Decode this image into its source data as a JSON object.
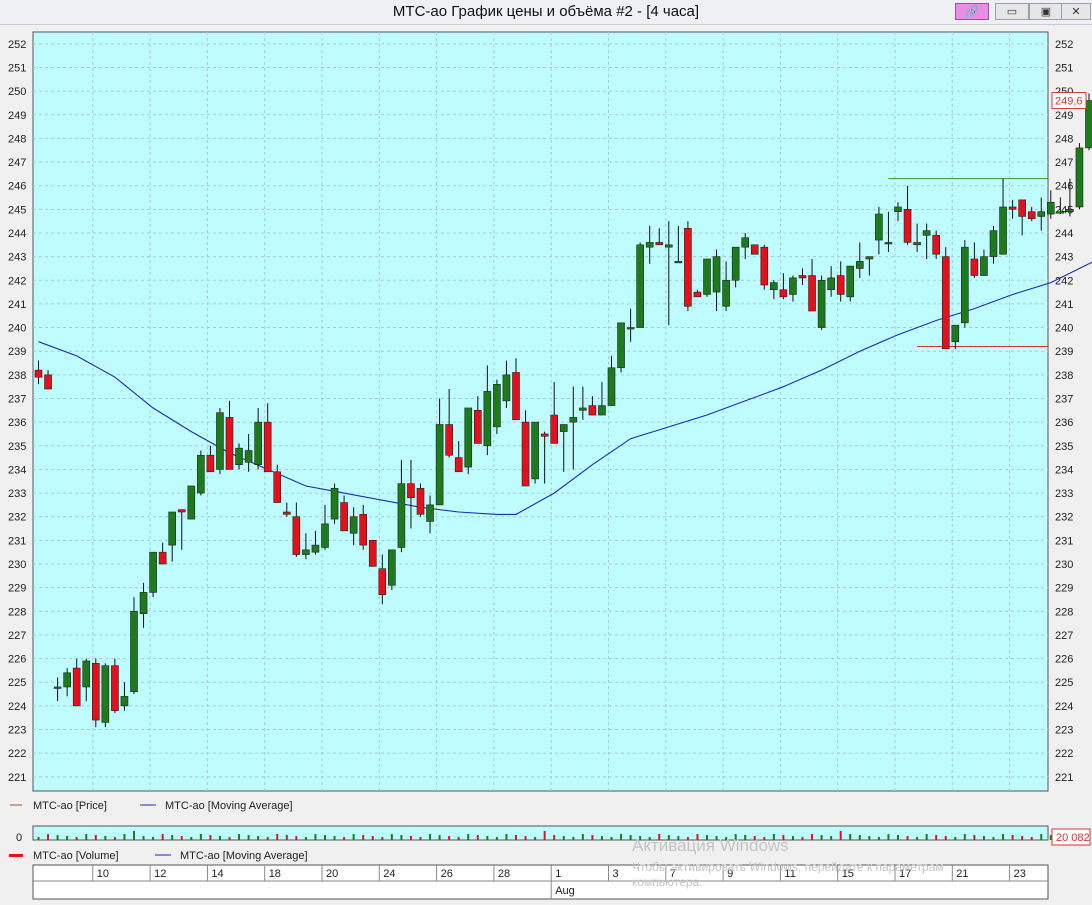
{
  "window": {
    "title": "МТС-ао График цены и объёма #2 - [4 часа]",
    "controls": [
      {
        "name": "link-icon",
        "glyph": "🔗"
      },
      {
        "name": "minimize-icon",
        "glyph": "▭"
      },
      {
        "name": "restore-icon",
        "glyph": "▣"
      },
      {
        "name": "close-icon",
        "glyph": "✕"
      }
    ]
  },
  "colors": {
    "background": "#bffcff",
    "grid": "#a8cccc",
    "up": "#1d7a1d",
    "down": "#e4101c",
    "ma": "#1a2cae",
    "resistance": "#2b9a2b",
    "support": "#d83030"
  },
  "chart_data": {
    "type": "candlestick",
    "ylim": [
      220.4,
      252.5
    ],
    "yticks": [
      221,
      222,
      223,
      224,
      225,
      226,
      227,
      228,
      229,
      230,
      231,
      232,
      233,
      234,
      235,
      236,
      237,
      238,
      239,
      240,
      241,
      242,
      243,
      244,
      245,
      246,
      247,
      248,
      249,
      250,
      251,
      252
    ],
    "grid": true,
    "candles": [
      [
        238.2,
        238.6,
        237.6,
        237.9
      ],
      [
        238.0,
        238.2,
        237.4,
        237.4
      ],
      [
        224.8,
        225.2,
        224.2,
        224.8
      ],
      [
        224.8,
        225.6,
        224.4,
        225.4
      ],
      [
        225.6,
        226.0,
        224.0,
        224.0
      ],
      [
        224.8,
        226.0,
        224.2,
        225.9
      ],
      [
        225.8,
        226.0,
        223.1,
        223.4
      ],
      [
        223.3,
        225.8,
        223.1,
        225.7
      ],
      [
        225.7,
        226.0,
        223.7,
        223.8
      ],
      [
        224.0,
        225.0,
        223.8,
        224.4
      ],
      [
        224.6,
        228.6,
        224.5,
        228.0
      ],
      [
        227.9,
        229.2,
        227.3,
        228.8
      ],
      [
        228.8,
        230.5,
        228.6,
        230.5
      ],
      [
        230.5,
        230.9,
        230.0,
        230.0
      ],
      [
        230.8,
        232.2,
        230.1,
        232.2
      ],
      [
        232.3,
        232.3,
        230.6,
        232.2
      ],
      [
        231.9,
        233.2,
        231.9,
        233.3
      ],
      [
        233.0,
        234.8,
        232.9,
        234.6
      ],
      [
        234.6,
        235.0,
        233.9,
        233.9
      ],
      [
        234.0,
        236.6,
        233.8,
        236.4
      ],
      [
        236.2,
        236.9,
        234.0,
        234.0
      ],
      [
        234.2,
        235.1,
        234.0,
        234.9
      ],
      [
        234.3,
        235.5,
        233.9,
        234.8
      ],
      [
        234.2,
        236.6,
        234.0,
        236.0
      ],
      [
        236.0,
        236.8,
        233.9,
        233.9
      ],
      [
        233.9,
        234.2,
        232.6,
        232.6
      ],
      [
        232.2,
        232.6,
        232.0,
        232.1
      ],
      [
        232.0,
        232.6,
        230.3,
        230.4
      ],
      [
        230.4,
        231.3,
        230.2,
        230.6
      ],
      [
        230.5,
        231.4,
        230.4,
        230.8
      ],
      [
        230.7,
        232.5,
        230.6,
        231.7
      ],
      [
        231.9,
        233.4,
        231.7,
        233.2
      ],
      [
        232.6,
        232.9,
        231.7,
        231.4
      ],
      [
        231.3,
        232.4,
        230.8,
        232.0
      ],
      [
        232.1,
        232.5,
        230.6,
        230.8
      ],
      [
        231.0,
        231.0,
        230.0,
        229.9
      ],
      [
        229.8,
        230.4,
        228.3,
        228.7
      ],
      [
        229.1,
        230.4,
        228.9,
        230.6
      ],
      [
        230.7,
        234.4,
        230.5,
        233.4
      ],
      [
        233.4,
        234.4,
        231.5,
        232.8
      ],
      [
        233.2,
        233.4,
        232.0,
        232.1
      ],
      [
        231.8,
        232.9,
        231.3,
        232.5
      ],
      [
        232.5,
        237.0,
        232.5,
        235.9
      ],
      [
        235.9,
        237.4,
        234.5,
        234.6
      ],
      [
        234.5,
        235.2,
        233.9,
        233.9
      ],
      [
        234.1,
        236.2,
        233.8,
        236.6
      ],
      [
        236.5,
        237.1,
        235.1,
        235.1
      ],
      [
        235.0,
        238.4,
        234.6,
        237.3
      ],
      [
        235.8,
        237.8,
        235.5,
        237.6
      ],
      [
        236.9,
        238.6,
        236.6,
        238.0
      ],
      [
        238.1,
        238.7,
        236.1,
        236.1
      ],
      [
        236.0,
        236.5,
        233.3,
        233.3
      ],
      [
        233.6,
        236.0,
        233.4,
        236.0
      ],
      [
        235.5,
        235.6,
        233.4,
        235.4
      ],
      [
        236.3,
        237.7,
        235.2,
        235.1
      ],
      [
        235.6,
        235.8,
        233.9,
        235.9
      ],
      [
        236.0,
        237.5,
        234.0,
        236.2
      ],
      [
        236.5,
        237.5,
        236.1,
        236.6
      ],
      [
        236.7,
        237.1,
        236.3,
        236.3
      ],
      [
        236.3,
        237.7,
        236.3,
        236.7
      ],
      [
        236.7,
        238.8,
        236.8,
        238.3
      ],
      [
        238.3,
        240.2,
        238.1,
        240.2
      ],
      [
        240.0,
        240.8,
        239.4,
        240.0
      ],
      [
        240.0,
        243.6,
        240.0,
        243.5
      ],
      [
        243.4,
        244.3,
        242.7,
        243.6
      ],
      [
        243.6,
        244.2,
        243.5,
        243.5
      ],
      [
        243.4,
        244.5,
        240.1,
        243.5
      ],
      [
        242.8,
        244.3,
        242.8,
        242.8
      ],
      [
        244.2,
        244.5,
        240.7,
        240.9
      ],
      [
        241.5,
        241.6,
        241.4,
        241.3
      ],
      [
        241.4,
        242.8,
        241.3,
        242.9
      ],
      [
        241.5,
        243.3,
        240.7,
        243.0
      ],
      [
        240.9,
        242.8,
        240.7,
        242.0
      ],
      [
        242.0,
        243.4,
        241.7,
        243.4
      ],
      [
        243.4,
        244.0,
        242.9,
        243.8
      ],
      [
        243.5,
        243.2,
        243.1,
        243.1
      ],
      [
        243.4,
        243.5,
        241.6,
        241.8
      ],
      [
        241.6,
        242.0,
        241.2,
        241.9
      ],
      [
        241.6,
        242.3,
        241.2,
        241.3
      ],
      [
        241.4,
        242.2,
        241.1,
        242.1
      ],
      [
        242.2,
        242.5,
        241.8,
        242.1
      ],
      [
        242.2,
        242.9,
        240.7,
        240.7
      ],
      [
        240.0,
        242.2,
        239.9,
        242.0
      ],
      [
        241.6,
        242.6,
        241.3,
        242.1
      ],
      [
        242.2,
        242.8,
        241.1,
        241.4
      ],
      [
        241.3,
        242.6,
        241.1,
        242.6
      ],
      [
        242.5,
        243.6,
        242.1,
        242.8
      ],
      [
        242.9,
        243.0,
        242.2,
        243.0
      ],
      [
        243.7,
        245.1,
        243.1,
        244.8
      ],
      [
        243.6,
        244.9,
        243.2,
        243.6
      ],
      [
        244.9,
        245.3,
        244.5,
        245.1
      ],
      [
        245.0,
        246.0,
        243.5,
        243.6
      ],
      [
        243.5,
        244.4,
        243.2,
        243.6
      ],
      [
        243.9,
        244.4,
        242.9,
        244.1
      ],
      [
        243.9,
        244.1,
        242.9,
        243.1
      ],
      [
        243.0,
        243.4,
        239.1,
        239.1
      ],
      [
        239.4,
        240.1,
        239.1,
        240.1
      ],
      [
        240.2,
        243.7,
        240.0,
        243.4
      ],
      [
        242.9,
        243.6,
        242.1,
        242.2
      ],
      [
        242.2,
        243.3,
        242.2,
        243.0
      ],
      [
        243.0,
        244.3,
        242.7,
        244.1
      ],
      [
        243.1,
        246.3,
        243.1,
        245.1
      ],
      [
        245.1,
        245.4,
        244.6,
        245.0
      ],
      [
        245.4,
        245.4,
        243.9,
        244.7
      ],
      [
        244.9,
        245.1,
        244.5,
        244.6
      ],
      [
        244.7,
        245.5,
        244.1,
        244.9
      ],
      [
        244.8,
        245.8,
        244.6,
        245.3
      ],
      [
        244.9,
        245.5,
        244.8,
        244.9
      ],
      [
        244.9,
        246.3,
        244.7,
        245.0
      ],
      [
        245.1,
        247.8,
        245.0,
        247.6
      ],
      [
        247.6,
        249.9,
        247.5,
        249.6
      ],
      [
        249.6,
        249.9,
        249.3,
        249.6
      ]
    ],
    "moving_average": [
      [
        0,
        239.4
      ],
      [
        4,
        238.8
      ],
      [
        8,
        237.9
      ],
      [
        12,
        236.6
      ],
      [
        16,
        235.6
      ],
      [
        20,
        234.7
      ],
      [
        24,
        234.0
      ],
      [
        28,
        233.3
      ],
      [
        32,
        233.0
      ],
      [
        36,
        232.7
      ],
      [
        40,
        232.4
      ],
      [
        44,
        232.2
      ],
      [
        48,
        232.1
      ],
      [
        50,
        232.1
      ],
      [
        54,
        233.0
      ],
      [
        58,
        234.2
      ],
      [
        62,
        235.3
      ],
      [
        66,
        235.8
      ],
      [
        70,
        236.3
      ],
      [
        74,
        236.9
      ],
      [
        78,
        237.5
      ],
      [
        82,
        238.2
      ],
      [
        86,
        239.0
      ],
      [
        90,
        239.7
      ],
      [
        94,
        240.3
      ],
      [
        98,
        240.8
      ],
      [
        102,
        241.4
      ],
      [
        106,
        241.9
      ],
      [
        110,
        242.7
      ],
      [
        113,
        243.3
      ]
    ],
    "price_label": "249,6",
    "resistance": {
      "value": 246.3,
      "from": 89
    },
    "support": {
      "value": 239.2,
      "from": 92
    },
    "legend": [
      {
        "label": "МТС-ао [Price]",
        "color": "#d83030"
      },
      {
        "label": "МТС-ао [Moving Average]",
        "color": "#1a2cae"
      }
    ],
    "volume": {
      "zero_label": "0",
      "value_label": "20 082",
      "legend": [
        {
          "label": "МТС-ао [Volume]",
          "color": "#e4101c"
        },
        {
          "label": "МТС-ао [Moving Average]",
          "color": "#1a2cae"
        }
      ]
    },
    "date_labels": [
      {
        "text": "10",
        "bar": 6
      },
      {
        "text": "12",
        "bar": 12
      },
      {
        "text": "14",
        "bar": 18
      },
      {
        "text": "18",
        "bar": 24
      },
      {
        "text": "20",
        "bar": 30
      },
      {
        "text": "24",
        "bar": 36
      },
      {
        "text": "26",
        "bar": 42
      },
      {
        "text": "28",
        "bar": 48
      },
      {
        "text": "1",
        "bar": 54
      },
      {
        "text": "3",
        "bar": 60
      },
      {
        "text": "7",
        "bar": 66
      },
      {
        "text": "9",
        "bar": 72
      },
      {
        "text": "11",
        "bar": 78
      },
      {
        "text": "15",
        "bar": 84
      },
      {
        "text": "17",
        "bar": 90
      },
      {
        "text": "21",
        "bar": 96
      },
      {
        "text": "23",
        "bar": 102
      }
    ],
    "month_label": {
      "text": "Aug",
      "bar": 54
    }
  },
  "watermark": {
    "line1": "Активация Windows",
    "line2": "Чтобы активировать Windows, перейдите к параметрам",
    "line3": "компьютера."
  }
}
